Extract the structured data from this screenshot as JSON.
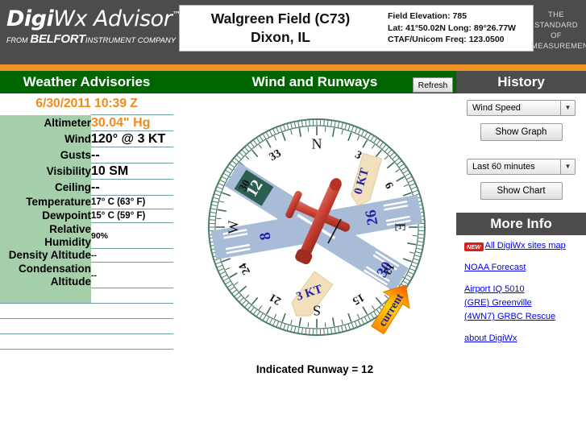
{
  "banner": {
    "logo_digi": "Digi",
    "logo_wx": "Wx",
    "logo_advisor": "Advisor",
    "logo_tm": "™",
    "logo_from": "FROM",
    "logo_belfort": "BELFORT",
    "logo_instco": "INSTRUMENT COMPANY",
    "airport_name_line1": "Walgreen Field (C73)",
    "airport_name_line2": "Dixon, IL",
    "field_elevation": "Field Elevation: 785",
    "lat_long": "Lat: 41°50.02N  Long: 89°26.77W",
    "ctaf": "CTAF/Unicom Freq: 123.0500",
    "tagline": "THE STANDARD OF MEASUREMENT",
    "accent_orange": "#f29424",
    "banner_gray": "#4c4c4c"
  },
  "headers": {
    "left": "Weather Advisories",
    "center": "Wind and Runways",
    "right": "History",
    "refresh": "Refresh",
    "green": "#006400"
  },
  "weather": {
    "timestamp": "6/30/2011 10:39 Z",
    "rows": [
      {
        "label": "Altimeter",
        "value": "30.04\" Hg",
        "style": "orange"
      },
      {
        "label": "Wind",
        "value": "120° @ 3 KT",
        "style": "big"
      },
      {
        "label": "Gusts",
        "value": "--",
        "style": "big"
      },
      {
        "label": "Visibility",
        "value": "10 SM",
        "style": "big"
      },
      {
        "label": "Ceiling",
        "value": "--",
        "style": "big"
      },
      {
        "label": "Temperature",
        "value": "17° C (63° F)",
        "style": "small"
      },
      {
        "label": "Dewpoint",
        "value": "15° C (59° F)",
        "style": "small"
      },
      {
        "label": "Relative Humidity",
        "value": "90%",
        "style": "tiny"
      },
      {
        "label": "Density Altitude",
        "value": "--",
        "style": "tiny"
      },
      {
        "label": "Condensation Altitude",
        "value": "--",
        "style": "tiny"
      }
    ]
  },
  "compass": {
    "cardinals": [
      {
        "label": "N",
        "deg": 0
      },
      {
        "label": "E",
        "deg": 90
      },
      {
        "label": "S",
        "deg": 180
      },
      {
        "label": "W",
        "deg": 270
      }
    ],
    "numbers": [
      {
        "label": "3",
        "deg": 30
      },
      {
        "label": "6",
        "deg": 60
      },
      {
        "label": "12",
        "deg": 120
      },
      {
        "label": "15",
        "deg": 150
      },
      {
        "label": "21",
        "deg": 210
      },
      {
        "label": "24",
        "deg": 240
      },
      {
        "label": "30",
        "deg": 300
      },
      {
        "label": "33",
        "deg": 330
      }
    ],
    "runways": [
      {
        "id_a": "12",
        "id_b": "30",
        "heading_deg": 120
      },
      {
        "id_a": "8",
        "id_b": "26",
        "heading_deg": 80
      }
    ],
    "crosswind_label": "0 KT",
    "headwind_label": "3 KT",
    "current_label": "current",
    "indicated_runway": "Indicated Runway = 12",
    "ring_color": "#4e7f6e",
    "runway_color": "#a8bcd8",
    "runway_marker_color": "#2c5f52",
    "plane_color": "#c0392b",
    "wind_text_color": "#2222aa"
  },
  "history": {
    "parameter_selected": "Wind Speed",
    "show_graph": "Show Graph",
    "range_selected": "Last 60 minutes",
    "show_chart": "Show Chart"
  },
  "more_info": {
    "title": "More Info",
    "new_badge": "NEW",
    "links": [
      "All DigiWx sites map",
      "NOAA Forecast",
      "Airport IQ 5010",
      "(GRE) Greenville",
      "(4WN7) GRBC Rescue",
      "about DigiWx"
    ]
  }
}
